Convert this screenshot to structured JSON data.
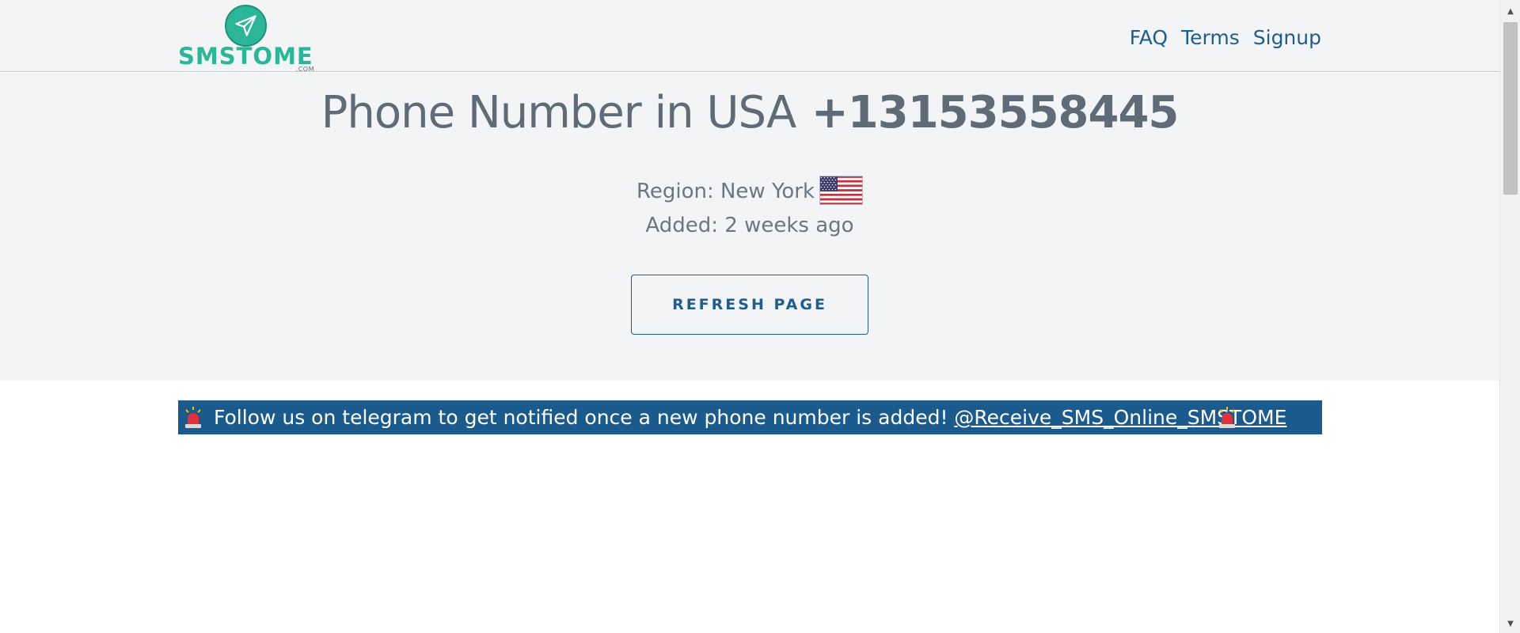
{
  "header": {
    "logo_text": "SMSTOME",
    "logo_sub": ".COM",
    "nav": [
      {
        "label": "FAQ"
      },
      {
        "label": "Terms"
      },
      {
        "label": "Signup"
      }
    ]
  },
  "hero": {
    "title_prefix": "Phone Number in USA",
    "phone_number": "+13153558445",
    "region": "Region: New York",
    "added": "Added: 2 weeks ago",
    "refresh_label": "REFRESH PAGE"
  },
  "banner": {
    "message": "Follow us on telegram to get notified once a new phone number is added!",
    "link_text": "@Receive_SMS_Online_SMSTOME"
  },
  "icons": {
    "logo": "paper-plane-icon",
    "flag": "us-flag-icon",
    "alert": "siren-icon"
  },
  "colors": {
    "brand_green": "#2bb697",
    "link_blue": "#1e5d8c",
    "banner_bg": "#1b5a8d",
    "hero_bg": "#f3f4f6",
    "title_gray": "#5f6c78"
  }
}
